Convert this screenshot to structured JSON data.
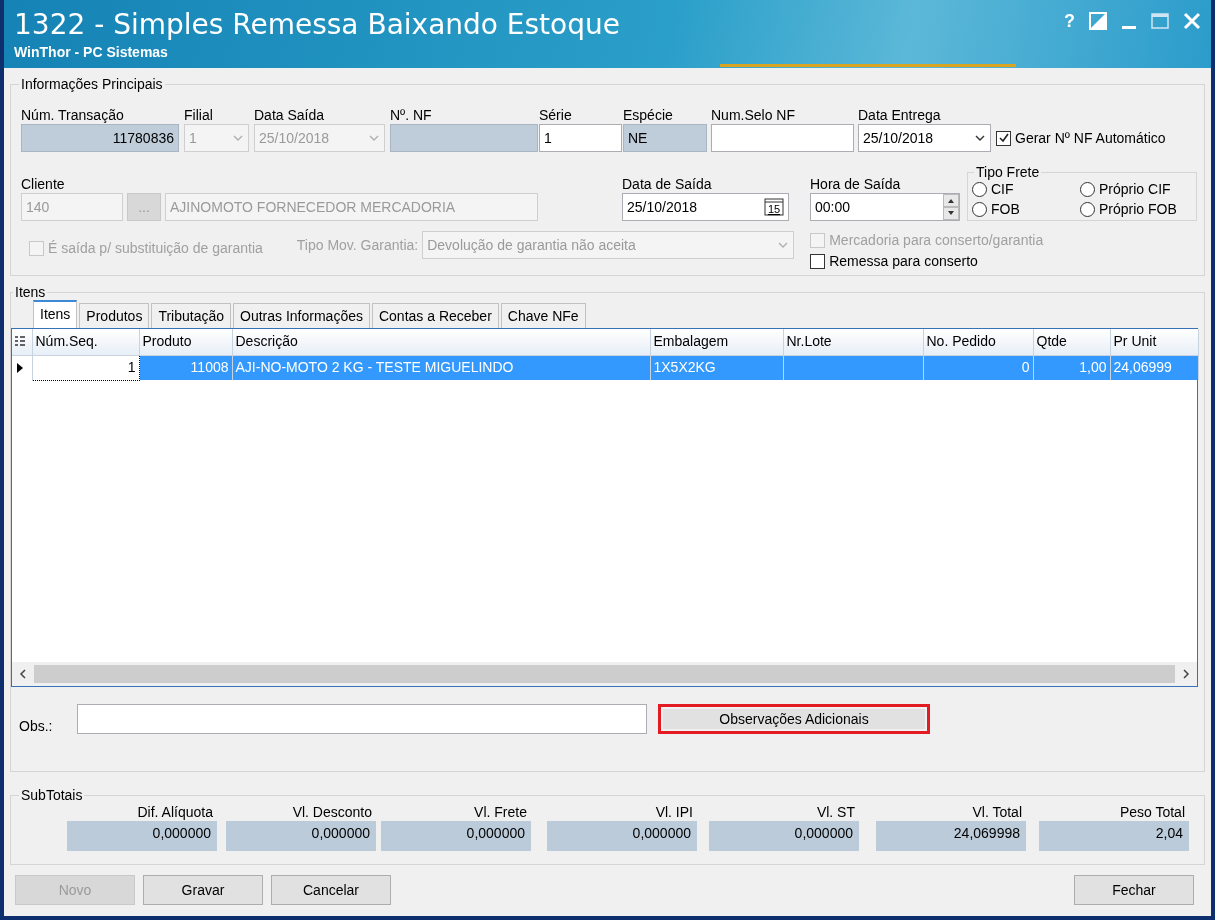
{
  "window": {
    "title": "1322 - Simples Remessa Baixando Estoque",
    "subtitle": "WinThor - PC Sistemas",
    "help": "?"
  },
  "main": {
    "legend": "Informações Principais",
    "fields": [
      {
        "label": "Núm. Transação",
        "value": "11780836",
        "kind": "readonly",
        "disabled": false
      },
      {
        "label": "Filial",
        "value": "1",
        "kind": "combo",
        "disabled": true
      },
      {
        "label": "Data Saída",
        "value": "25/10/2018",
        "kind": "combo",
        "disabled": true
      },
      {
        "label": "Nº. NF",
        "kind": "readonly",
        "disabled": false
      },
      {
        "label": "Série",
        "value": "1",
        "kind": "text",
        "disabled": false
      },
      {
        "label": "Espécie",
        "value": "NE",
        "kind": "readonly",
        "disabled": false
      },
      {
        "label": "Num.Selo NF",
        "kind": "text",
        "disabled": false
      },
      {
        "label": "Data Entrega",
        "value": "25/10/2018",
        "kind": "combo",
        "disabled": false
      }
    ],
    "auto_nf": {
      "label": "Gerar Nº NF Automático",
      "checked": true,
      "disabled": false
    },
    "cliente": {
      "label": "Cliente",
      "code": "140",
      "lookup": "...",
      "name": "AJINOMOTO FORNECEDOR MERCADORIA",
      "disabled": true
    },
    "data_saida": {
      "label": "Data de Saída",
      "value": "25/10/2018",
      "calendar": "15"
    },
    "hora_saida": {
      "label": "Hora de Saída",
      "value": "00:00"
    },
    "tipo_frete": {
      "legend": "Tipo Frete",
      "options": [
        {
          "label": "CIF",
          "selected": false
        },
        {
          "label": "Próprio CIF",
          "selected": false
        },
        {
          "label": "FOB",
          "selected": false
        },
        {
          "label": "Próprio FOB",
          "selected": false
        }
      ]
    },
    "garantia": {
      "label": "É saída p/ substituição de garantia",
      "checked": false,
      "disabled": true
    },
    "tipo_mov": {
      "label": "Tipo Mov. Garantia:",
      "value": "Devolução de garantia não aceita",
      "disabled": true
    },
    "checks": [
      {
        "label": "Mercadoria para conserto/garantia",
        "checked": false,
        "disabled": true
      },
      {
        "label": "Remessa para conserto",
        "checked": false,
        "disabled": false
      }
    ]
  },
  "itens": {
    "legend": "Itens",
    "tabs": [
      {
        "label": "Itens",
        "selected": true
      },
      {
        "label": "Produtos",
        "selected": false
      },
      {
        "label": "Tributação",
        "selected": false
      },
      {
        "label": "Outras Informações",
        "selected": false
      },
      {
        "label": "Contas a Receber",
        "selected": false
      },
      {
        "label": "Chave NFe",
        "selected": false
      }
    ],
    "table": {
      "columns": [
        "Núm.Seq.",
        "Produto",
        "Descrição",
        "Embalagem",
        "Nr.Lote",
        "No. Pedido",
        "Qtde",
        "Pr Unit"
      ],
      "rows": [
        {
          "selected": true,
          "cells": [
            "1",
            "11008",
            "AJI-NO-MOTO 2 KG - TESTE MIGUELINDO",
            "1X5X2KG",
            "",
            "0",
            "1,00",
            "24,06999"
          ]
        }
      ]
    },
    "obs": {
      "label": "Obs.:"
    },
    "obs_button": {
      "label": "Observações Adicionais",
      "highlighted": true
    }
  },
  "subtotais": {
    "legend": "SubTotais",
    "items": [
      {
        "label": "Dif. Alíquota",
        "value": "0,000000"
      },
      {
        "label": "Vl. Desconto",
        "value": "0,000000"
      },
      {
        "label": "Vl. Frete",
        "value": "0,000000"
      },
      {
        "label": "Vl. IPI",
        "value": "0,000000"
      },
      {
        "label": "Vl. ST",
        "value": "0,000000"
      },
      {
        "label": "Vl. Total",
        "value": "24,069998"
      },
      {
        "label": "Peso Total",
        "value": "2,04"
      }
    ]
  },
  "buttons": [
    {
      "label": "Novo",
      "disabled": true
    },
    {
      "label": "Gravar",
      "disabled": false
    },
    {
      "label": "Cancelar",
      "disabled": false
    },
    {
      "label": "Fechar",
      "disabled": false
    }
  ]
}
